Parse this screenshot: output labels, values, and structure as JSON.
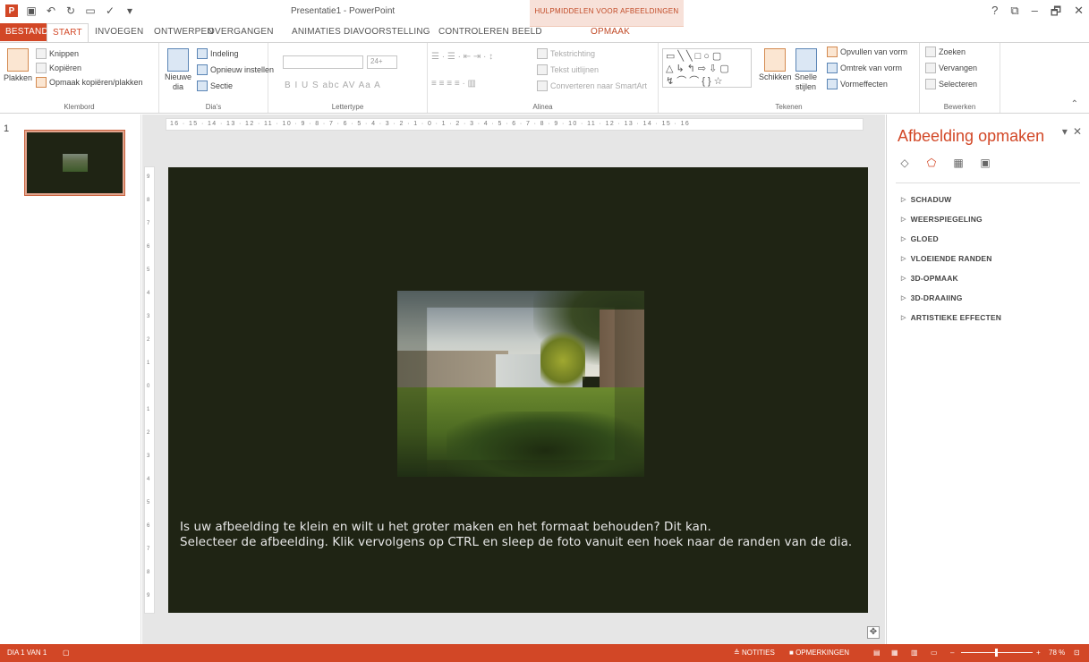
{
  "app": {
    "doc_title": "Presentatie1 - PowerPoint",
    "context_tab_header": "HULPMIDDELEN VOOR AFBEELDINGEN",
    "window_controls": [
      "?",
      "⧉",
      "–",
      "🗗",
      "✕"
    ]
  },
  "tabs": {
    "file": "BESTAND",
    "items": [
      "START",
      "INVOEGEN",
      "ONTWERPEN",
      "OVERGANGEN",
      "ANIMATIES",
      "DIAVOORSTELLING",
      "CONTROLEREN",
      "BEELD",
      "OPMAAK"
    ],
    "active": "START"
  },
  "ribbon": {
    "clipboard": {
      "paste": "Plakken",
      "cut": "Knippen",
      "copy": "Kopiëren",
      "format_painter": "Opmaak kopiëren/plakken",
      "label": "Klembord"
    },
    "slides": {
      "new_slide_1": "Nieuwe",
      "new_slide_2": "dia",
      "layout": "Indeling",
      "reset": "Opnieuw instellen",
      "section": "Sectie",
      "label": "Dia's"
    },
    "font": {
      "size": "24+",
      "label": "Lettertype",
      "buttons": "B  I  U  S  abc  AV  Aa  A"
    },
    "paragraph": {
      "text_direction": "Tekstrichting",
      "align_text": "Tekst uitlijnen",
      "convert_smartart": "Converteren naar SmartArt",
      "label": "Alinea"
    },
    "drawing": {
      "arrange": "Schikken",
      "quick_styles_1": "Snelle",
      "quick_styles_2": "stijlen",
      "shape_fill": "Opvullen van vorm",
      "shape_outline": "Omtrek van vorm",
      "shape_effects": "Vormeffecten",
      "label": "Tekenen"
    },
    "editing": {
      "find": "Zoeken",
      "replace": "Vervangen",
      "select": "Selecteren",
      "label": "Bewerken"
    }
  },
  "thumbnails": {
    "slide_number": "1"
  },
  "ruler": {
    "horizontal": "16 · 15 · 14 · 13 · 12 · 11 · 10 · 9 · 8 · 7 · 6 · 5 · 4 · 3 · 2 · 1 · 0 · 1 · 2 · 3 · 4 · 5 · 6 · 7 · 8 · 9 · 10 · 11 · 12 · 13 · 14 · 15 · 16",
    "vertical": [
      "9",
      "8",
      "7",
      "6",
      "5",
      "4",
      "3",
      "2",
      "1",
      "0",
      "1",
      "2",
      "3",
      "4",
      "5",
      "6",
      "7",
      "8",
      "9"
    ]
  },
  "slide": {
    "caption_line1": "Is uw afbeelding te klein en wilt u het groter maken en het formaat behouden? Dit kan.",
    "caption_line2": "Selecteer de afbeelding. Klik vervolgens op CTRL en sleep de foto vanuit een hoek naar de randen van de dia.",
    "background_color": "#1f2414"
  },
  "format_pane": {
    "title": "Afbeelding opmaken",
    "sections": [
      "SCHADUW",
      "WEERSPIEGELING",
      "GLOED",
      "VLOEIENDE RANDEN",
      "3D-OPMAAK",
      "3D-DRAAIING",
      "ARTISTIEKE EFFECTEN"
    ]
  },
  "statusbar": {
    "slide_of": "DIA 1 VAN 1",
    "notes": "NOTITIES",
    "comments": "OPMERKINGEN",
    "zoom": "78 %",
    "accent_color": "#d24726"
  }
}
